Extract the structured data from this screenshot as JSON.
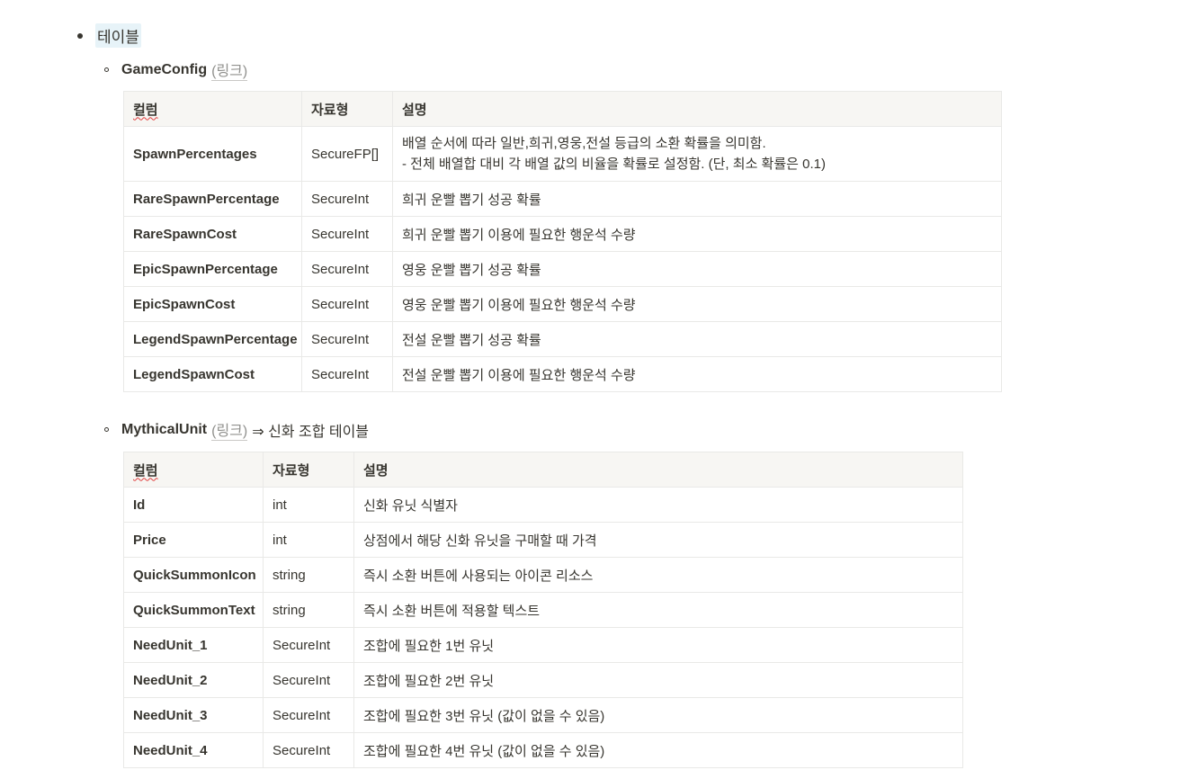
{
  "section": {
    "title": "테이블"
  },
  "game_config": {
    "name": "GameConfig",
    "link_label": "(링크)",
    "headers": [
      "컬럼",
      "자료형",
      "설명"
    ],
    "rows": [
      {
        "column": "SpawnPercentages",
        "type": "SecureFP[]",
        "desc": "배열 순서에 따라 일반,희귀,영웅,전설 등급의 소환 확률을 의미함.",
        "desc2": "- 전체 배열합 대비 각 배열 값의 비율을 확률로 설정함. (단, 최소 확률은 0.1)"
      },
      {
        "column": "RareSpawnPercentage",
        "type": "SecureInt",
        "desc": "희귀 운빨 뽑기 성공 확률"
      },
      {
        "column": "RareSpawnCost",
        "type": "SecureInt",
        "desc": "희귀 운빨 뽑기 이용에 필요한 행운석 수량"
      },
      {
        "column": "EpicSpawnPercentage",
        "type": "SecureInt",
        "desc": "영웅 운빨 뽑기 성공 확률"
      },
      {
        "column": "EpicSpawnCost",
        "type": "SecureInt",
        "desc": "영웅 운빨 뽑기 이용에 필요한 행운석 수량"
      },
      {
        "column": "LegendSpawnPercentage",
        "type": "SecureInt",
        "desc": "전설 운빨 뽑기 성공 확률"
      },
      {
        "column": "LegendSpawnCost",
        "type": "SecureInt",
        "desc": "전설 운빨 뽑기 이용에 필요한 행운석 수량"
      }
    ]
  },
  "mythical_unit": {
    "name": "MythicalUnit",
    "link_label": "(링크)",
    "description": "⇒ 신화 조합 테이블",
    "headers": [
      "컬럼",
      "자료형",
      "설명"
    ],
    "rows": [
      {
        "column": "Id",
        "type": "int",
        "desc": "신화 유닛 식별자"
      },
      {
        "column": "Price",
        "type": "int",
        "desc": "상점에서 해당 신화 유닛을 구매할 때 가격"
      },
      {
        "column": "QuickSummonIcon",
        "type": "string",
        "desc": "즉시 소환 버튼에 사용되는 아이콘 리소스"
      },
      {
        "column": "QuickSummonText",
        "type": "string",
        "desc": "즉시 소환 버튼에 적용할 텍스트"
      },
      {
        "column": "NeedUnit_1",
        "type": "SecureInt",
        "desc": "조합에 필요한 1번 유닛"
      },
      {
        "column": "NeedUnit_2",
        "type": "SecureInt",
        "desc": "조합에 필요한 2번 유닛"
      },
      {
        "column": "NeedUnit_3",
        "type": "SecureInt",
        "desc": "조합에 필요한 3번 유닛 (값이 없을 수 있음)"
      },
      {
        "column": "NeedUnit_4",
        "type": "SecureInt",
        "desc": "조합에 필요한 4번 유닛 (값이 없을 수 있음)"
      }
    ]
  }
}
